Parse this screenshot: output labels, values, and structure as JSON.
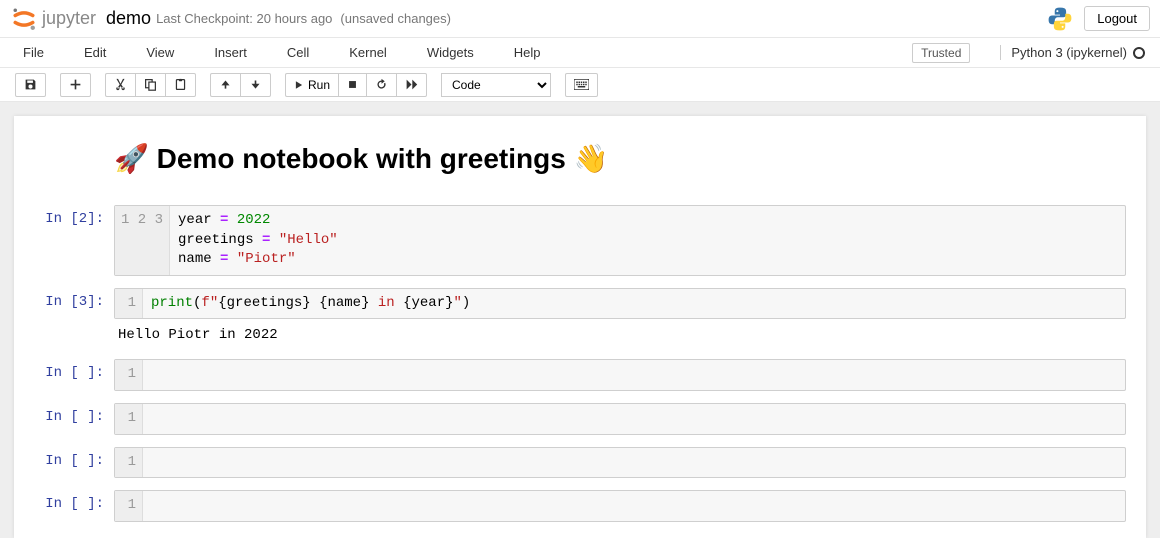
{
  "header": {
    "logo_text": "jupyter",
    "notebook_name": "demo",
    "checkpoint": "Last Checkpoint: 20 hours ago",
    "unsaved": "(unsaved changes)",
    "logout": "Logout"
  },
  "menu": {
    "items": [
      "File",
      "Edit",
      "View",
      "Insert",
      "Cell",
      "Kernel",
      "Widgets",
      "Help"
    ],
    "trusted": "Trusted",
    "kernel": "Python 3 (ipykernel)"
  },
  "toolbar": {
    "run": "Run",
    "cell_type": "Code"
  },
  "cells": [
    {
      "type": "markdown",
      "html": "🚀 Demo notebook with greetings 👋"
    },
    {
      "type": "code",
      "prompt": "In [2]:",
      "lines": [
        [
          {
            "t": "year ",
            "c": "tok-var"
          },
          {
            "t": "=",
            "c": "tok-op"
          },
          {
            "t": " ",
            "c": ""
          },
          {
            "t": "2022",
            "c": "tok-num"
          }
        ],
        [
          {
            "t": "greetings ",
            "c": "tok-var"
          },
          {
            "t": "=",
            "c": "tok-op"
          },
          {
            "t": " ",
            "c": ""
          },
          {
            "t": "\"Hello\"",
            "c": "tok-str"
          }
        ],
        [
          {
            "t": "name ",
            "c": "tok-var"
          },
          {
            "t": "=",
            "c": "tok-op"
          },
          {
            "t": " ",
            "c": ""
          },
          {
            "t": "\"Piotr\"",
            "c": "tok-str"
          }
        ]
      ]
    },
    {
      "type": "code",
      "prompt": "In [3]:",
      "lines": [
        [
          {
            "t": "print",
            "c": "tok-fn"
          },
          {
            "t": "(",
            "c": ""
          },
          {
            "t": "f\"",
            "c": "tok-fstr"
          },
          {
            "t": "{greetings}",
            "c": "tok-fint"
          },
          {
            "t": " ",
            "c": "tok-fstr"
          },
          {
            "t": "{name}",
            "c": "tok-fint"
          },
          {
            "t": " in ",
            "c": "tok-fstr"
          },
          {
            "t": "{year}",
            "c": "tok-fint"
          },
          {
            "t": "\"",
            "c": "tok-fstr"
          },
          {
            "t": ")",
            "c": ""
          }
        ]
      ],
      "output": "Hello Piotr in 2022"
    },
    {
      "type": "code",
      "prompt": "In [ ]:",
      "lines": [
        []
      ]
    },
    {
      "type": "code",
      "prompt": "In [ ]:",
      "lines": [
        []
      ]
    },
    {
      "type": "code",
      "prompt": "In [ ]:",
      "lines": [
        []
      ]
    },
    {
      "type": "code",
      "prompt": "In [ ]:",
      "lines": [
        []
      ]
    }
  ]
}
